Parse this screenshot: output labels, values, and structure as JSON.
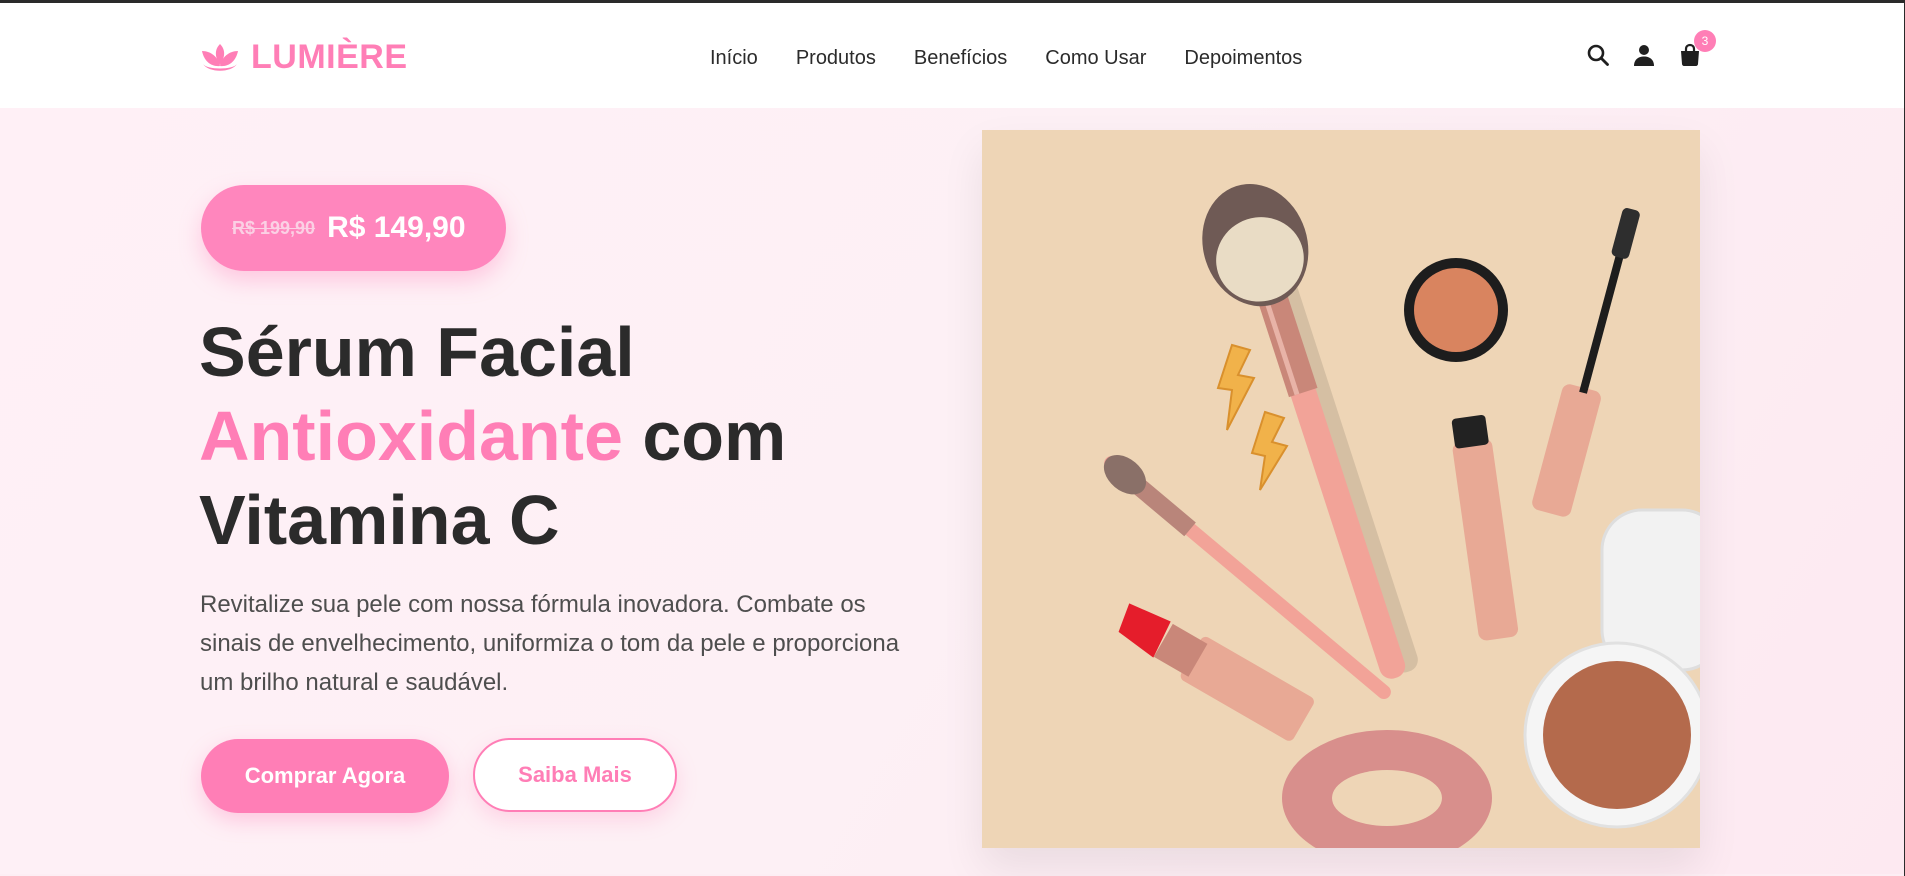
{
  "brand": {
    "name": "LUMIÈRE",
    "color": "#ff7eb6"
  },
  "nav": {
    "items": [
      "Início",
      "Produtos",
      "Benefícios",
      "Como Usar",
      "Depoimentos"
    ]
  },
  "header_icons": {
    "search": "search-icon",
    "user": "user-icon",
    "cart": "shopping-bag-icon",
    "cart_count": "3"
  },
  "hero": {
    "old_price": "R$ 199,90",
    "new_price": "R$ 149,90",
    "title_part1": "Sérum Facial",
    "title_accent": "Antioxidante",
    "title_part2": "com",
    "title_part3": "Vitamina C",
    "description": "Revitalize sua pele com nossa fórmula inovadora. Combate os sinais de envelhecimento, uniformiza o tom da pele e proporciona um brilho natural e saudável.",
    "primary_button": "Comprar Agora",
    "secondary_button": "Saiba Mais"
  }
}
